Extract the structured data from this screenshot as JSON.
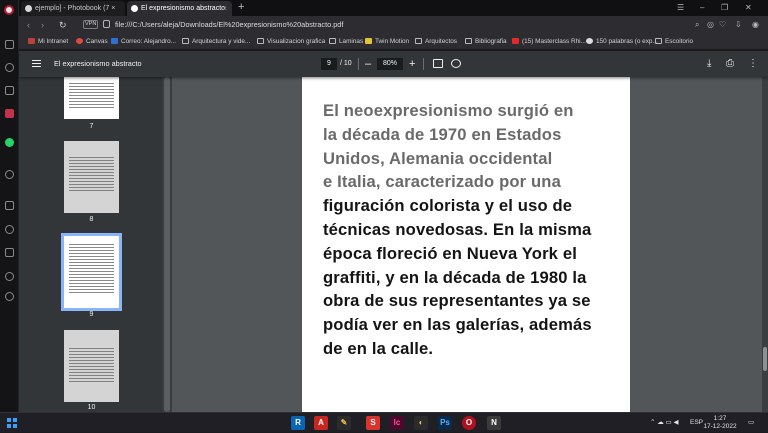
{
  "tabs": [
    {
      "label": "ejemplo] - Photobook (7 ×",
      "close": "×"
    },
    {
      "label": "El expresionismo abstracto",
      "close": "×"
    }
  ],
  "new_tab": "+",
  "window_controls": [
    "☰",
    "–",
    "❐",
    "✕"
  ],
  "nav": {
    "back": "‹",
    "forward": "›",
    "reload": "↻",
    "vpn": "VPN",
    "url": "file:///C:/Users/aleja/Downloads/El%20expresionismo%20abstracto.pdf"
  },
  "nav_right_icons": [
    "⌕",
    "◎",
    "♡",
    "⇩",
    "◉"
  ],
  "bookmarks": [
    {
      "label": "Mi Intranet",
      "color": "#b8423a"
    },
    {
      "label": "Canvas",
      "color": "#d94b3f"
    },
    {
      "label": "Correo: Alejandro...",
      "color": "#2f6fd1"
    },
    {
      "label": "Arquitectura y vide...",
      "color": "folder"
    },
    {
      "label": "Visualizacion grafica",
      "color": "folder"
    },
    {
      "label": "Laminas",
      "color": "folder"
    },
    {
      "label": "Twin Motion",
      "color": "#e2c437"
    },
    {
      "label": "Arquitectos",
      "color": "folder"
    },
    {
      "label": "Bibliografia",
      "color": "folder"
    },
    {
      "label": "(15) Masterclass Rhi...",
      "color": "#e32a2a"
    },
    {
      "label": "150 palabras (o exp...",
      "color": "#dcdcdc"
    },
    {
      "label": "Escoitorio",
      "color": "folder"
    }
  ],
  "pdf": {
    "title": "El expresionismo abstracto",
    "page": "9",
    "total": "/ 10",
    "zoom_minus": "–",
    "zoom": "80%",
    "zoom_plus": "+",
    "download": "⤓",
    "print": "⎙",
    "more": "⋮"
  },
  "thumbnails": [
    {
      "num": "7"
    },
    {
      "num": "8"
    },
    {
      "num": "9"
    },
    {
      "num": "10"
    }
  ],
  "page_lines": [
    "El neoexpresionismo surgió en",
    "la década de 1970 en Estados",
    "Unidos, Alemania occidental",
    "e Italia, caracterizado por una",
    "figuración colorista y el uso de",
    "técnicas novedosas. En la misma",
    "época floreció en Nueva York el",
    "graffiti, y en la década de 1980 la",
    "obra de sus representantes ya se",
    "podía ver en las galerías, además",
    "de en la calle."
  ],
  "taskbar": {
    "apps": [
      {
        "label": "R",
        "color": "#0a65b5"
      },
      {
        "label": "A",
        "color": "#c7271f"
      },
      {
        "label": "✎",
        "color": "#2b2b2b"
      },
      {
        "label": "S",
        "color": "#d8342b"
      },
      {
        "label": "Ic",
        "color": "#4a0a2b"
      },
      {
        "label": "◐",
        "color": "#2b2b2b"
      },
      {
        "label": "Ps",
        "color": "#0b2a4a"
      },
      {
        "label": "O",
        "color": "#b01020"
      },
      {
        "label": "N",
        "color": "#3a3a3a"
      }
    ],
    "lang": "ESP",
    "time": "1:27",
    "date": "17-12-2022"
  }
}
